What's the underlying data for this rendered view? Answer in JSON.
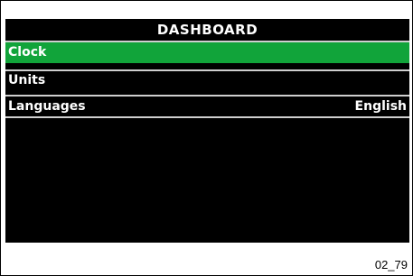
{
  "screen": {
    "title": "DASHBOARD",
    "menu": [
      {
        "label": "Clock",
        "value": "",
        "selected": true
      },
      {
        "label": "Units",
        "value": "",
        "selected": false
      },
      {
        "label": "Languages",
        "value": "English",
        "selected": false
      }
    ]
  },
  "figure_id": "02_79",
  "colors": {
    "screen_background": "#000000",
    "selection_highlight": "#11a43a",
    "text": "#ffffff",
    "divider": "#cfcfcf"
  }
}
